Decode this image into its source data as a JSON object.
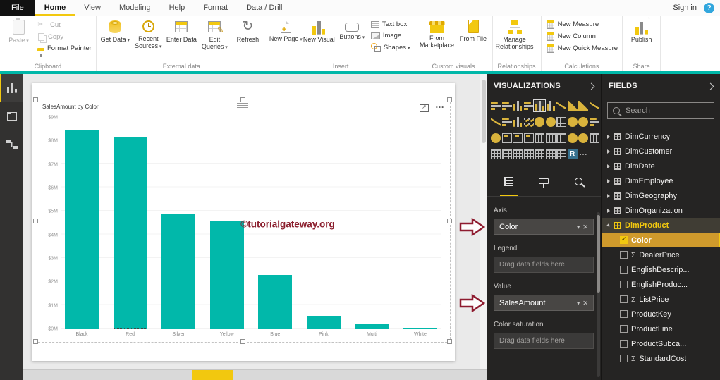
{
  "titlebar": {
    "tabs": [
      "File",
      "Home",
      "View",
      "Modeling",
      "Help",
      "Format",
      "Data / Drill"
    ],
    "active_tab": "Home",
    "sign_in_label": "Sign in",
    "help_icon_text": "?"
  },
  "ribbon": {
    "clipboard": {
      "label": "Clipboard",
      "paste": "Paste",
      "cut": "Cut",
      "copy": "Copy",
      "format_painter": "Format Painter"
    },
    "external_data": {
      "label": "External data",
      "get_data": "Get Data",
      "recent_sources": "Recent Sources",
      "enter_data": "Enter Data",
      "edit_queries": "Edit Queries",
      "refresh": "Refresh"
    },
    "insert": {
      "label": "Insert",
      "new_page": "New Page",
      "new_visual": "New Visual",
      "buttons": "Buttons",
      "text_box": "Text box",
      "image": "Image",
      "shapes": "Shapes"
    },
    "custom_visuals": {
      "label": "Custom visuals",
      "from_marketplace": "From Marketplace",
      "from_file": "From File"
    },
    "relationships": {
      "label": "Relationships",
      "manage_relationships": "Manage Relationships"
    },
    "calculations": {
      "label": "Calculations",
      "new_measure": "New Measure",
      "new_column": "New Column",
      "new_quick_measure": "New Quick Measure"
    },
    "share": {
      "label": "Share",
      "publish": "Publish"
    }
  },
  "left_nav": {
    "items": [
      "report-view",
      "data-view",
      "model-view"
    ],
    "active": "report-view"
  },
  "canvas": {
    "watermark": "©tutorialgateway.org"
  },
  "chart_data": {
    "type": "bar",
    "title": "SalesAmount by Color",
    "categories": [
      "Black",
      "Red",
      "Silver",
      "Yellow",
      "Blue",
      "Pink",
      "Multi",
      "White"
    ],
    "values": [
      8.5,
      8.2,
      4.9,
      4.6,
      2.3,
      0.55,
      0.18,
      0.04
    ],
    "y_format": "$M",
    "xlabel": "Color",
    "ylabel": "SalesAmount",
    "ylim": [
      0,
      9
    ],
    "yticks": [
      "$9M",
      "$8M",
      "$7M",
      "$6M",
      "$5M",
      "$4M",
      "$3M",
      "$2M",
      "$1M",
      "$0M"
    ],
    "bar_color": "#01b8aa",
    "highlighted_bar": "Red",
    "legend": "none",
    "grid": "faint"
  },
  "visualizations": {
    "title": "VISUALIZATIONS",
    "icons": [
      "stacked-bar-chart",
      "clustered-bar-chart",
      "stacked-column-chart",
      "100-stacked-bar-chart",
      "clustered-column-chart",
      "100-stacked-column-chart",
      "line-chart",
      "area-chart",
      "stacked-area-chart",
      "line-and-stacked-column-chart",
      "line-and-clustered-column-chart",
      "ribbon-chart",
      "waterfall-chart",
      "scatter-chart",
      "pie-chart",
      "donut-chart",
      "treemap",
      "map",
      "filled-map",
      "funnel-chart",
      "gauge",
      "card",
      "multi-row-card",
      "kpi",
      "slicer",
      "table",
      "matrix",
      "arcgis-map",
      "shape-map",
      "custom-visual-1",
      "custom-visual-2",
      "custom-visual-3",
      "custom-visual-4",
      "custom-visual-5",
      "custom-visual-6",
      "custom-visual-7",
      "custom-visual-8",
      "r-script-visual",
      "ellipsis"
    ],
    "selected_icon": "clustered-column-chart",
    "selected_icon_index": 4,
    "tabs": [
      "fields",
      "format",
      "analytics"
    ],
    "active_tab": "fields",
    "wells": {
      "axis_label": "Axis",
      "axis_value": "Color",
      "legend_label": "Legend",
      "legend_placeholder": "Drag data fields here",
      "value_label": "Value",
      "value_value": "SalesAmount",
      "saturation_label": "Color saturation",
      "saturation_placeholder": "Drag data fields here"
    }
  },
  "fields_panel": {
    "title": "FIELDS",
    "search_placeholder": "Search",
    "tables": [
      {
        "name": "DimCurrency"
      },
      {
        "name": "DimCustomer"
      },
      {
        "name": "DimDate"
      },
      {
        "name": "DimEmployee"
      },
      {
        "name": "DimGeography"
      },
      {
        "name": "DimOrganization"
      },
      {
        "name": "DimProduct",
        "expanded": true,
        "selected": true
      }
    ],
    "dimproduct_fields": [
      {
        "name": "Color",
        "checked": true,
        "selected": true
      },
      {
        "name": "DealerPrice",
        "sigma": true
      },
      {
        "name": "EnglishDescrip..."
      },
      {
        "name": "EnglishProduc..."
      },
      {
        "name": "ListPrice",
        "sigma": true
      },
      {
        "name": "ProductKey"
      },
      {
        "name": "ProductLine"
      },
      {
        "name": "ProductSubca..."
      },
      {
        "name": "StandardCost",
        "sigma": true
      }
    ]
  }
}
